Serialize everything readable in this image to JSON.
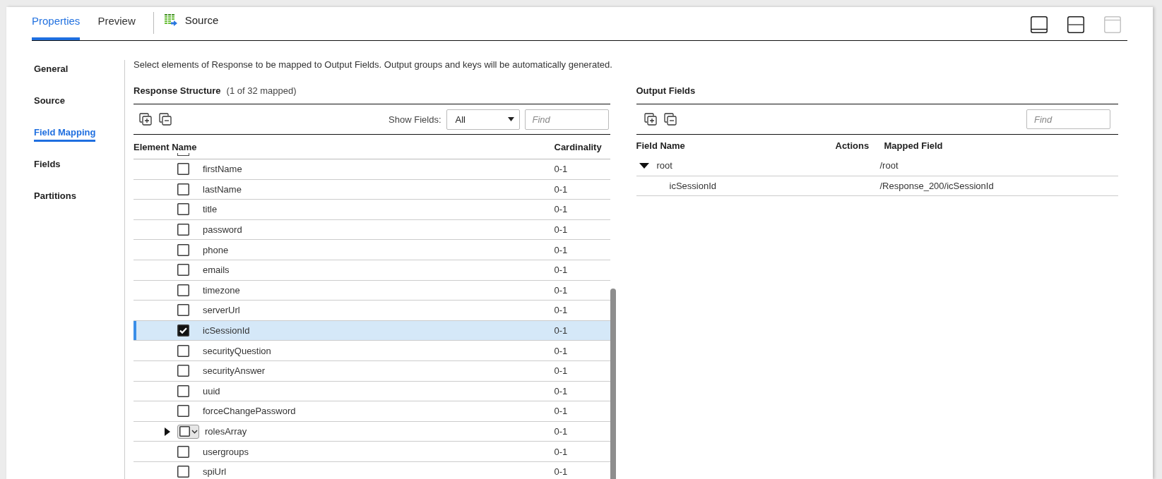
{
  "tabs": [
    {
      "label": "Properties",
      "selected": true
    },
    {
      "label": "Preview",
      "selected": false
    }
  ],
  "object": {
    "label": "Source"
  },
  "layout_buttons": [
    {
      "kind": "bottom",
      "disabled": false
    },
    {
      "kind": "split",
      "disabled": false
    },
    {
      "kind": "top",
      "disabled": true
    }
  ],
  "sidebar": {
    "items": [
      {
        "label": "General",
        "selected": false
      },
      {
        "label": "Source",
        "selected": false
      },
      {
        "label": "Field Mapping",
        "selected": true
      },
      {
        "label": "Fields",
        "selected": false
      },
      {
        "label": "Partitions",
        "selected": false
      }
    ]
  },
  "description": "Select elements of Response to be mapped to Output Fields. Output groups and keys will be automatically generated.",
  "response_structure": {
    "title": "Response Structure",
    "summary": "(1 of 32 mapped)",
    "show_fields": {
      "label": "Show Fields:",
      "value": "All"
    },
    "find": {
      "placeholder": "Find"
    },
    "columns": [
      "Element Name",
      "Cardinality"
    ],
    "rows": [
      {
        "kind": "leaf",
        "name": "firstName",
        "cardinality": "0-1",
        "checked": false,
        "selected": false
      },
      {
        "kind": "leaf",
        "name": "lastName",
        "cardinality": "0-1",
        "checked": false,
        "selected": false
      },
      {
        "kind": "leaf",
        "name": "title",
        "cardinality": "0-1",
        "checked": false,
        "selected": false
      },
      {
        "kind": "leaf",
        "name": "password",
        "cardinality": "0-1",
        "checked": false,
        "selected": false
      },
      {
        "kind": "leaf",
        "name": "phone",
        "cardinality": "0-1",
        "checked": false,
        "selected": false
      },
      {
        "kind": "leaf",
        "name": "emails",
        "cardinality": "0-1",
        "checked": false,
        "selected": false
      },
      {
        "kind": "leaf",
        "name": "timezone",
        "cardinality": "0-1",
        "checked": false,
        "selected": false
      },
      {
        "kind": "leaf",
        "name": "serverUrl",
        "cardinality": "0-1",
        "checked": false,
        "selected": false
      },
      {
        "kind": "leaf",
        "name": "icSessionId",
        "cardinality": "0-1",
        "checked": true,
        "selected": true
      },
      {
        "kind": "leaf",
        "name": "securityQuestion",
        "cardinality": "0-1",
        "checked": false,
        "selected": false
      },
      {
        "kind": "leaf",
        "name": "securityAnswer",
        "cardinality": "0-1",
        "checked": false,
        "selected": false
      },
      {
        "kind": "leaf",
        "name": "uuid",
        "cardinality": "0-1",
        "checked": false,
        "selected": false
      },
      {
        "kind": "leaf",
        "name": "forceChangePassword",
        "cardinality": "0-1",
        "checked": false,
        "selected": false
      },
      {
        "kind": "group",
        "name": "rolesArray",
        "cardinality": "0-1",
        "checked": false,
        "selected": false,
        "expanded": false
      },
      {
        "kind": "leaf",
        "name": "usergroups",
        "cardinality": "0-1",
        "checked": false,
        "selected": false
      },
      {
        "kind": "leaf",
        "name": "spiUrl",
        "cardinality": "0-1",
        "checked": false,
        "selected": false
      }
    ]
  },
  "output_fields": {
    "title": "Output Fields",
    "find": {
      "placeholder": "Find"
    },
    "columns": [
      "Field Name",
      "Actions",
      "Mapped Field"
    ],
    "rows": [
      {
        "name": "root",
        "mapped_field": "/root",
        "expanded": true,
        "children": [
          {
            "name": "icSessionId",
            "mapped_field": "/Response_200/icSessionId"
          }
        ]
      }
    ]
  }
}
